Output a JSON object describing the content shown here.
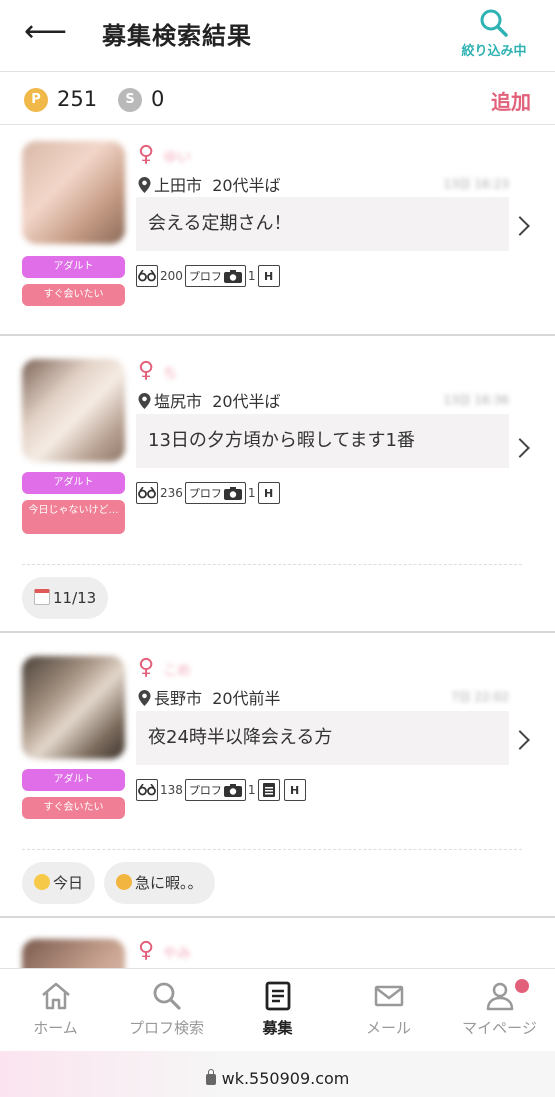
{
  "header": {
    "back_glyph": "⟵",
    "title": "募集検索結果",
    "filter_label": "絞り込み中"
  },
  "points": {
    "p_symbol": "P",
    "p_value": "251",
    "s_symbol": "S",
    "s_value": "0",
    "add_label": "追加"
  },
  "posts": [
    {
      "gender": "♀",
      "location": "上田市",
      "age": "20代半ば",
      "message": "会える定期さん！",
      "view_count": "200",
      "prof_label": "プロフ",
      "photo_count": "1",
      "tags": [
        "アダルト",
        "すぐ会いたい"
      ]
    },
    {
      "gender": "♀",
      "location": "塩尻市",
      "age": "20代半ば",
      "message": "13日の夕方頃から暇してます1番",
      "view_count": "236",
      "prof_label": "プロフ",
      "photo_count": "1",
      "tags": [
        "アダルト",
        "今日じゃないけど…"
      ],
      "chips": [
        {
          "icon": "calendar-icon",
          "text": "11/13"
        }
      ]
    },
    {
      "gender": "♀",
      "location": "長野市",
      "age": "20代前半",
      "message": "夜24時半以降会える方",
      "view_count": "138",
      "prof_label": "プロフ",
      "photo_count": "1",
      "tags": [
        "アダルト",
        "すぐ会いたい"
      ],
      "chips": [
        {
          "icon": "heart-eyes-icon",
          "text": "今日"
        },
        {
          "icon": "tired-face-icon",
          "text": "急に暇。。"
        }
      ]
    },
    {
      "gender": "♀"
    }
  ],
  "nav": [
    {
      "label": "ホーム",
      "icon": "home-icon"
    },
    {
      "label": "プロフ検索",
      "icon": "search-icon"
    },
    {
      "label": "募集",
      "icon": "list-icon",
      "active": true
    },
    {
      "label": "メール",
      "icon": "mail-icon"
    },
    {
      "label": "マイページ",
      "icon": "user-icon",
      "badge": true
    }
  ],
  "url": "wk.550909.com",
  "colors": {
    "accent_pink": "#e2607a",
    "teal": "#2fb2b3",
    "adult_tag": "#e06ee8",
    "pink_tag": "#f07e94",
    "coin_gold": "#f1b84a",
    "coin_silver": "#b9b9b9"
  }
}
